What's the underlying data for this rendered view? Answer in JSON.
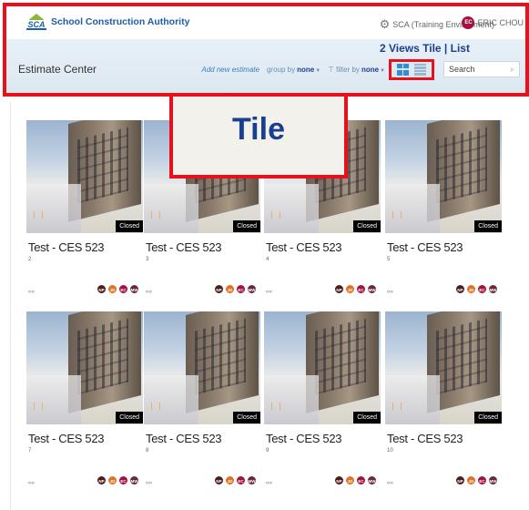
{
  "header": {
    "logo_mark": "SCA",
    "logo_text": "School Construction Authority",
    "environment": "SCA (Training Environment)",
    "user_initials": "EC",
    "user_name": "ERIC CHOU",
    "views_label": "2 Views  Tile | List",
    "page_title": "Estimate Center"
  },
  "toolbar": {
    "add_estimate": "Add new estimate",
    "group_by_label": "group by",
    "group_by_value": "none",
    "filter_by_label": "filter by",
    "filter_by_value": "none",
    "search_placeholder": "Search"
  },
  "callout": {
    "label": "Tile"
  },
  "estimates": [
    {
      "title": "Test - CES 523",
      "number": "2",
      "status": "Closed",
      "avatars": [
        "NP",
        "JD",
        "EC",
        "MW"
      ]
    },
    {
      "title": "Test - CES 523",
      "number": "3",
      "status": "Closed",
      "avatars": [
        "NP",
        "JD",
        "EC",
        "MW"
      ]
    },
    {
      "title": "Test - CES 523",
      "number": "4",
      "status": "Closed",
      "avatars": [
        "NP",
        "JD",
        "EC",
        "MW"
      ]
    },
    {
      "title": "Test - CES 523",
      "number": "5",
      "status": "Closed",
      "avatars": [
        "NP",
        "JD",
        "EC",
        "MW"
      ]
    },
    {
      "title": "Test - CES 523",
      "number": "7",
      "status": "Closed",
      "avatars": [
        "NP",
        "JD",
        "EC",
        "MW"
      ]
    },
    {
      "title": "Test - CES 523",
      "number": "8",
      "status": "Closed",
      "avatars": [
        "NP",
        "JD",
        "EC",
        "MW"
      ]
    },
    {
      "title": "Test - CES 523",
      "number": "9",
      "status": "Closed",
      "avatars": [
        "NP",
        "JD",
        "EC",
        "MW"
      ]
    },
    {
      "title": "Test - CES 523",
      "number": "10",
      "status": "Closed",
      "avatars": [
        "NP",
        "JD",
        "EC",
        "MW"
      ]
    }
  ],
  "colors": {
    "highlight_border": "#e8101a",
    "brand_blue": "#1b5da8",
    "title_blue": "#1b3f8f"
  }
}
